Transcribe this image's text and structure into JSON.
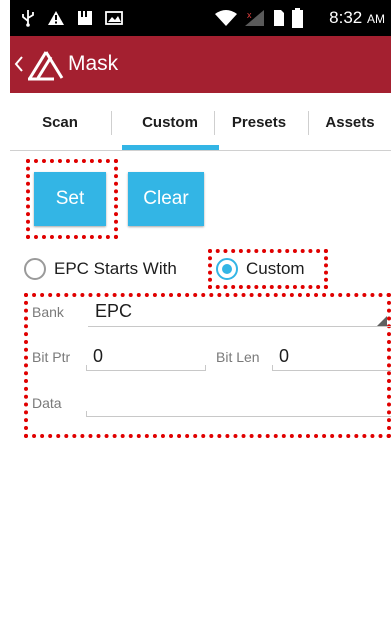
{
  "status_bar": {
    "time": "8:32",
    "ampm": "AM",
    "icons": [
      "usb-icon",
      "warning-icon",
      "storage-icon",
      "image-icon",
      "wifi-icon",
      "signal-icon",
      "sim-icon",
      "battery-icon"
    ]
  },
  "app_bar": {
    "title": "Mask",
    "icons": [
      "back-chevron-icon",
      "app-logo-icon"
    ]
  },
  "tabs": [
    {
      "label": "Scan",
      "selected": false
    },
    {
      "label": "Custom",
      "selected": true
    },
    {
      "label": "Presets",
      "selected": false
    },
    {
      "label": "Assets",
      "selected": false
    }
  ],
  "buttons": {
    "set": "Set",
    "clear": "Clear"
  },
  "radios": [
    {
      "label": "EPC Starts With",
      "checked": false
    },
    {
      "label": "Custom",
      "checked": true
    }
  ],
  "form": {
    "bank_label": "Bank",
    "bank_value": "EPC",
    "bit_ptr_label": "Bit Ptr",
    "bit_ptr_value": "0",
    "bit_len_label": "Bit Len",
    "bit_len_value": "0",
    "data_label": "Data",
    "data_value": ""
  },
  "colors": {
    "app_bar": "#a42030",
    "accent": "#33b5e5",
    "highlight": "#e00000",
    "status_bar": "#000000"
  }
}
